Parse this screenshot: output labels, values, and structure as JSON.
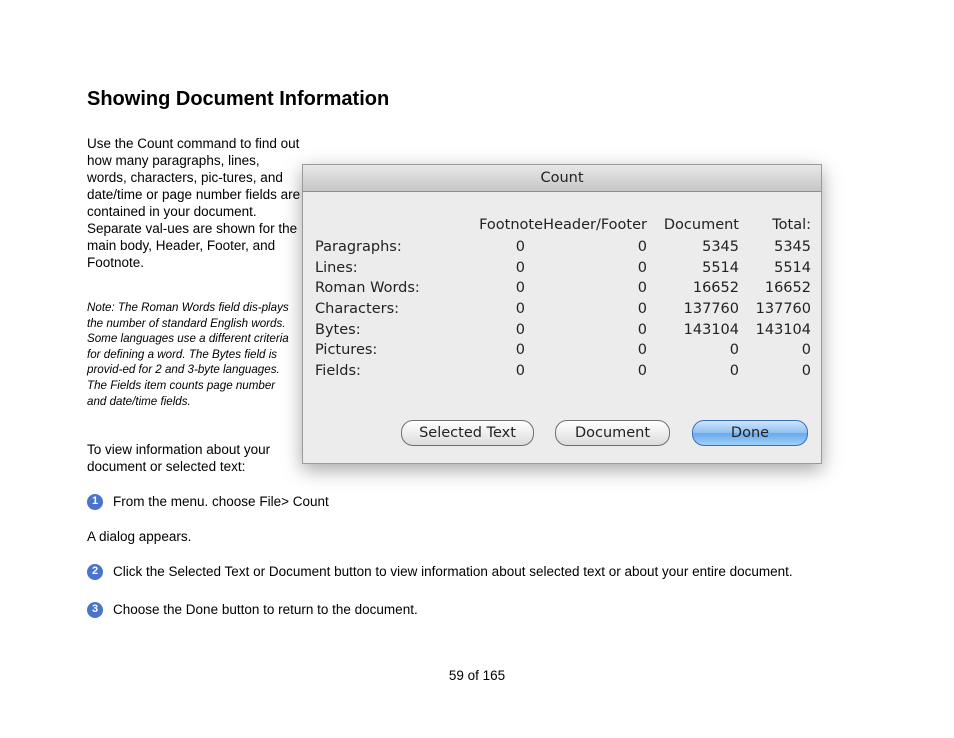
{
  "page": {
    "title": "Showing Document Information",
    "intro": "Use the Count command to find out how many paragraphs, lines, words, characters, pic-tures, and date/time or page number fields are contained in your document. Separate val-ues are shown for the main body, Header, Footer, and Footnote.",
    "note": "Note: The Roman Words field dis-plays the number of standard English words. Some languages use a different criteria for defining a word. The Bytes field is provid-ed for 2 and 3-byte languages. The Fields item counts page number and date/time fields.",
    "view_info": "To view information about your document or selected text:",
    "steps": [
      {
        "num": "1",
        "text": "From the menu. choose File> Count"
      },
      {
        "num": "2",
        "text": "Click the Selected Text or Document button to view information about selected text or about your entire document."
      },
      {
        "num": "3",
        "text": "Choose the Done button to return to the document."
      }
    ],
    "dialog_appears": "A dialog appears.",
    "footer": "59 of 165"
  },
  "dialog": {
    "title": "Count",
    "headers": [
      "",
      "Footnote",
      "Header/Footer",
      "Document",
      "Total:"
    ],
    "rows": [
      {
        "label": "Paragraphs:",
        "footnote": "0",
        "header_footer": "0",
        "document": "5345",
        "total": "5345"
      },
      {
        "label": "Lines:",
        "footnote": "0",
        "header_footer": "0",
        "document": "5514",
        "total": "5514"
      },
      {
        "label": "Roman Words:",
        "footnote": "0",
        "header_footer": "0",
        "document": "16652",
        "total": "16652"
      },
      {
        "label": "Characters:",
        "footnote": "0",
        "header_footer": "0",
        "document": "137760",
        "total": "137760"
      },
      {
        "label": "Bytes:",
        "footnote": "0",
        "header_footer": "0",
        "document": "143104",
        "total": "143104"
      },
      {
        "label": "Pictures:",
        "footnote": "0",
        "header_footer": "0",
        "document": "0",
        "total": "0"
      },
      {
        "label": "Fields:",
        "footnote": "0",
        "header_footer": "0",
        "document": "0",
        "total": "0"
      }
    ],
    "buttons": {
      "selected_text": "Selected Text",
      "document": "Document",
      "done": "Done"
    }
  }
}
